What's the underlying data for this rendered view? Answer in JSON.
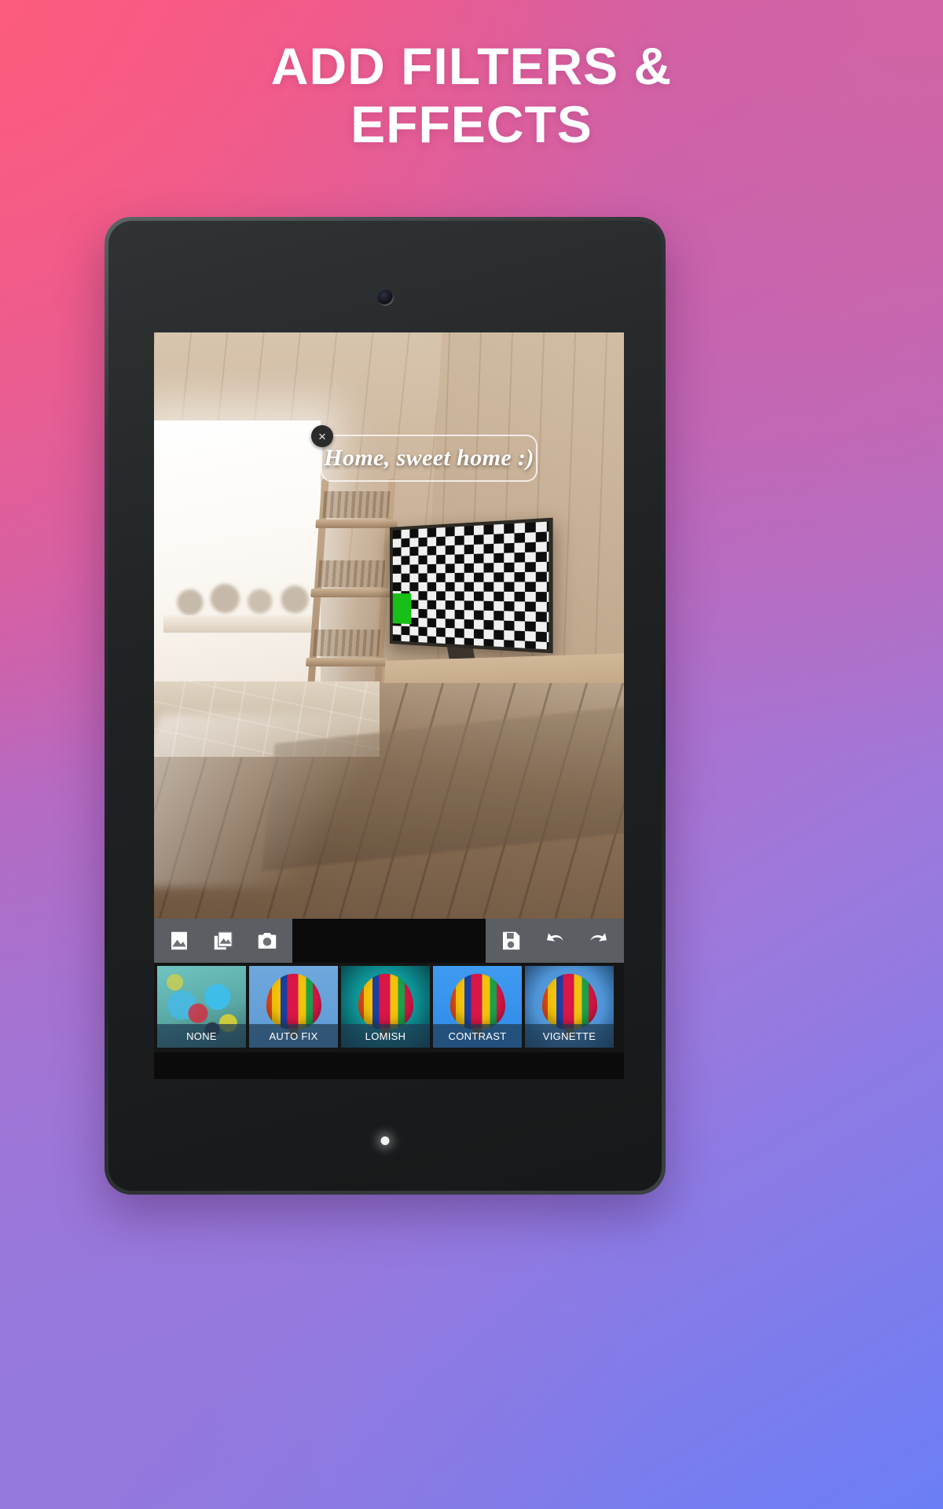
{
  "headline": {
    "line1": "ADD FILTERS &",
    "line2": "EFFECTS"
  },
  "theme": {
    "bg_top_left": "#fb5c7f",
    "bg_top_right": "#d064a4",
    "bg_bottom_left": "#9478dc",
    "bg_bottom_right": "#6b7ef5",
    "headline_color": "#ffffff",
    "toolbar_bg": "#6c7278",
    "filter_strip_bg": "#151515",
    "filter_label_bg": "#1e3a52"
  },
  "device": {
    "type": "tablet-mockup",
    "bezel_color": "#1a1d1e",
    "camera": "front-camera-lens",
    "indicator": "notification-led"
  },
  "editor": {
    "photo": {
      "description": "Interior room with wooden walls, ladder bookshelf, TV showing checkerboard test pattern with green square, white cat near bright window, wooden floor"
    },
    "sticker": {
      "text": "Home, sweet home :)",
      "close_label": "×"
    },
    "toolbar_left": [
      {
        "name": "single-photo-icon",
        "label": "Photo"
      },
      {
        "name": "multi-photo-icon",
        "label": "Collage"
      },
      {
        "name": "camera-icon",
        "label": "Camera"
      }
    ],
    "toolbar_right": [
      {
        "name": "save-icon",
        "label": "Save"
      },
      {
        "name": "undo-icon",
        "label": "Undo"
      },
      {
        "name": "redo-icon",
        "label": "Redo"
      }
    ],
    "filters": [
      {
        "label": "NONE",
        "thumb": "butterfly",
        "selected": true
      },
      {
        "label": "AUTO FIX",
        "thumb": "balloon-auto",
        "selected": false
      },
      {
        "label": "LOMISH",
        "thumb": "balloon-lomish",
        "selected": false
      },
      {
        "label": "CONTRAST",
        "thumb": "balloon-contrast",
        "selected": false
      },
      {
        "label": "VIGNETTE",
        "thumb": "balloon-vignette",
        "selected": false
      }
    ]
  }
}
